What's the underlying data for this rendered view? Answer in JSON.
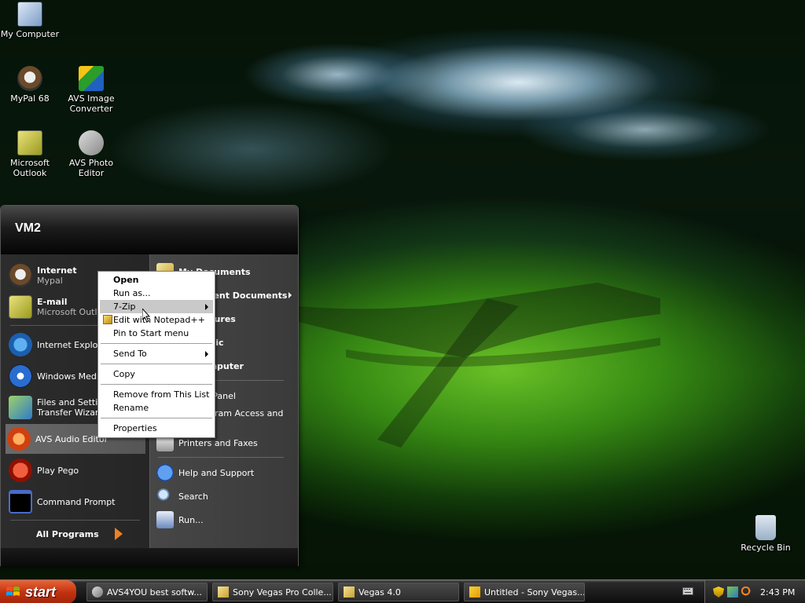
{
  "desktop": {
    "icons": [
      {
        "label": "My Computer",
        "icon": "my-computer-icon"
      },
      {
        "label": "MyPal 68",
        "icon": "mypal-icon"
      },
      {
        "label": "AVS Image Converter",
        "icon": "avs-image-converter-icon"
      },
      {
        "label": "Microsoft Outlook",
        "icon": "outlook-icon"
      },
      {
        "label": "AVS Photo Editor",
        "icon": "avs-photo-editor-icon"
      },
      {
        "label": "Recycle Bin",
        "icon": "recycle-bin-icon"
      }
    ]
  },
  "start_menu": {
    "user_name": "VM2",
    "pinned": [
      {
        "title": "Internet",
        "subtitle": "Mypal",
        "icon": "mypal-icon"
      },
      {
        "title": "E-mail",
        "subtitle": "Microsoft Outlook",
        "icon": "outlook-icon"
      }
    ],
    "recent": [
      {
        "label": "Internet Explorer",
        "icon": "internet-explorer-icon"
      },
      {
        "label": "Windows Media Player",
        "icon": "media-player-icon"
      },
      {
        "label": "Files and Settings Transfer Wizard",
        "icon": "transfer-wizard-icon"
      },
      {
        "label": "AVS Audio Editor",
        "icon": "avs-audio-editor-icon"
      },
      {
        "label": "Play Pego",
        "icon": "pego-icon"
      },
      {
        "label": "Command Prompt",
        "icon": "command-prompt-icon"
      }
    ],
    "all_programs_label": "All Programs",
    "right_items": [
      {
        "label": "My Documents",
        "icon": "my-documents-icon",
        "bold": true
      },
      {
        "label": "My Recent Documents",
        "icon": "recent-documents-icon",
        "bold": true,
        "submenu": true
      },
      {
        "label": "My Pictures",
        "icon": "my-pictures-icon",
        "bold": true
      },
      {
        "label": "My Music",
        "icon": "my-music-icon",
        "bold": true
      },
      {
        "label": "My Computer",
        "icon": "my-computer-icon",
        "bold": true
      },
      {
        "label": "Control Panel",
        "icon": "control-panel-icon",
        "bold": false
      },
      {
        "label": "Set Program Access and Defaults",
        "icon": "program-access-icon",
        "bold": false
      },
      {
        "label": "Printers and Faxes",
        "icon": "printers-icon",
        "bold": false
      },
      {
        "label": "Help and Support",
        "icon": "help-icon",
        "bold": false
      },
      {
        "label": "Search",
        "icon": "search-icon",
        "bold": false
      },
      {
        "label": "Run...",
        "icon": "run-icon",
        "bold": false
      }
    ]
  },
  "context_menu": {
    "items": [
      {
        "label": "Open",
        "bold": true
      },
      {
        "label": "Run as..."
      },
      {
        "label": "7-Zip",
        "submenu": true,
        "hovered": true
      },
      {
        "label": "Edit with Notepad++",
        "icon": "notepad-plus-plus-icon"
      },
      {
        "label": "Pin to Start menu"
      },
      {
        "label": "Send To",
        "submenu": true
      },
      {
        "label": "Copy"
      },
      {
        "label": "Remove from This List"
      },
      {
        "label": "Rename"
      },
      {
        "label": "Properties"
      }
    ]
  },
  "taskbar": {
    "start_label": "start",
    "buttons": [
      {
        "label": "AVS4YOU best softw...",
        "icon": "avs4you-icon"
      },
      {
        "label": "Sony Vegas Pro Colle...",
        "icon": "sony-vegas-folder-icon"
      },
      {
        "label": "Vegas 4.0",
        "icon": "folder-icon"
      },
      {
        "label": "Untitled - Sony Vegas...",
        "icon": "sony-vegas-icon"
      }
    ],
    "clock": "2:43 PM"
  }
}
